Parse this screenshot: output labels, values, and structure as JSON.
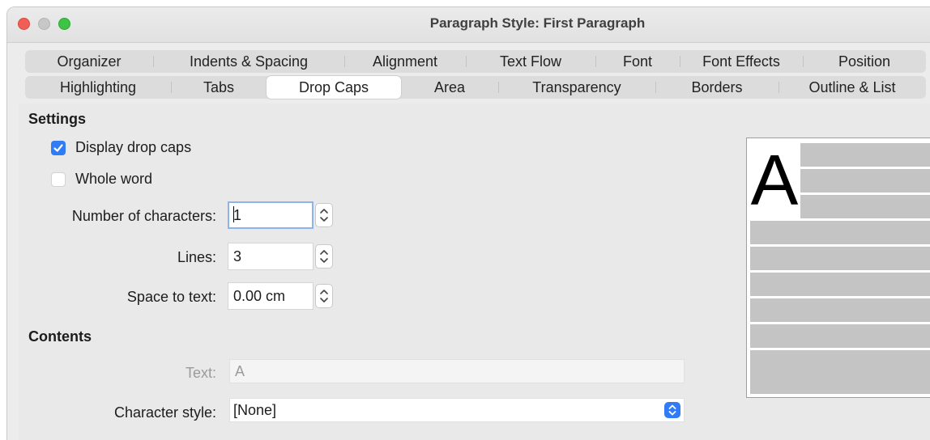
{
  "window": {
    "title": "Paragraph Style: First Paragraph"
  },
  "tabs": {
    "row1": [
      "Organizer",
      "Indents & Spacing",
      "Alignment",
      "Text Flow",
      "Font",
      "Font Effects",
      "Position"
    ],
    "row2": [
      "Highlighting",
      "Tabs",
      "Drop Caps",
      "Area",
      "Transparency",
      "Borders",
      "Outline & List"
    ],
    "active": "Drop Caps"
  },
  "settings": {
    "heading": "Settings",
    "display_drop_caps": {
      "label": "Display drop caps",
      "checked": true
    },
    "whole_word": {
      "label": "Whole word",
      "checked": false
    },
    "number_of_characters": {
      "label": "Number of characters:",
      "value": "1"
    },
    "lines": {
      "label": "Lines:",
      "value": "3"
    },
    "space_to_text": {
      "label": "Space to text:",
      "value": "0.00 cm"
    }
  },
  "contents": {
    "heading": "Contents",
    "text": {
      "label": "Text:",
      "value": "A"
    },
    "character_style": {
      "label": "Character style:",
      "value": "[None]"
    }
  },
  "preview": {
    "letter": "A"
  },
  "colors": {
    "accent": "#2f7cf6",
    "close": "#ee5f57",
    "maximize": "#3ec248"
  }
}
